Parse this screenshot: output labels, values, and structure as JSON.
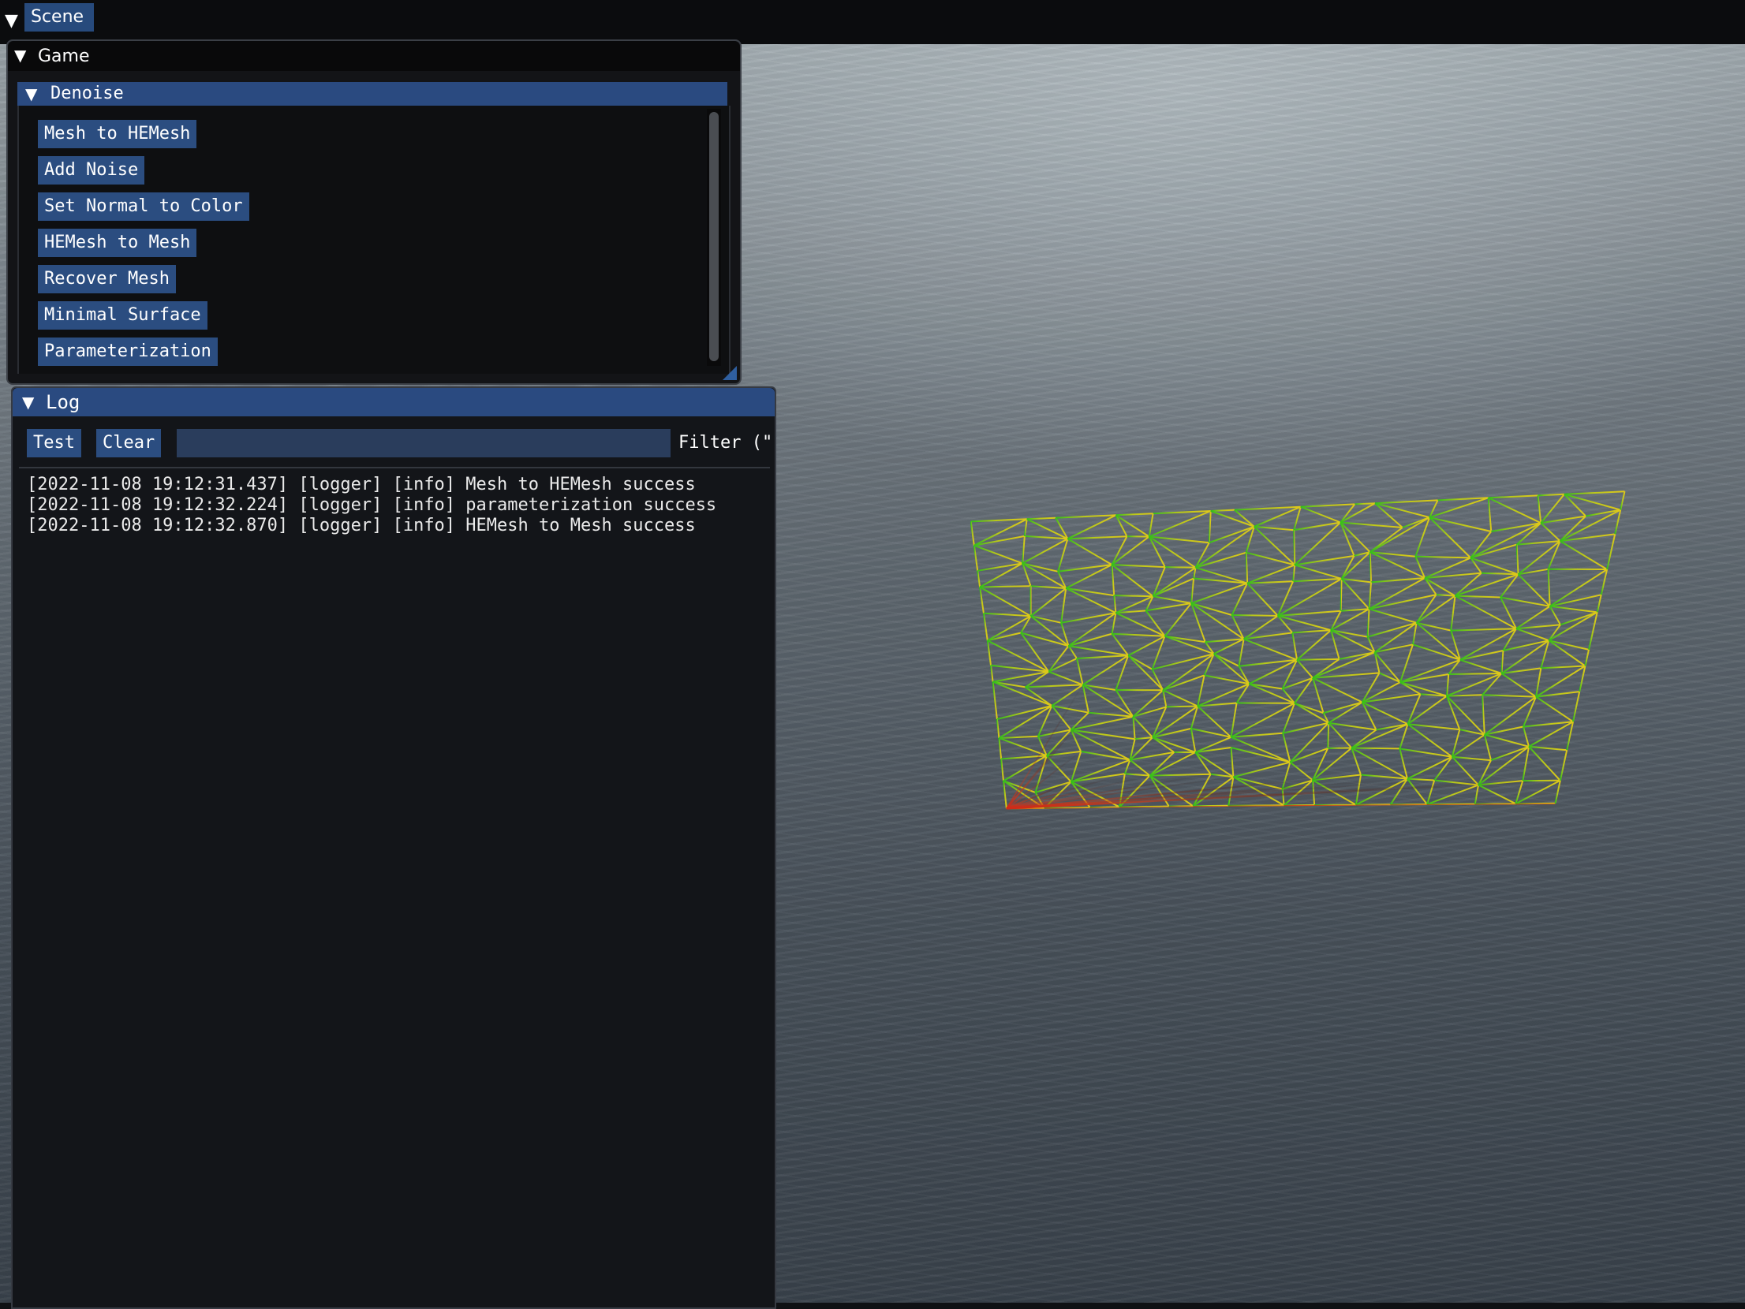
{
  "scene_tab": {
    "label": "Scene"
  },
  "game_window": {
    "title": "Game",
    "section_title": "Denoise",
    "buttons": [
      "Mesh to HEMesh",
      "Add Noise",
      "Set Normal to Color",
      "HEMesh to Mesh",
      "Recover Mesh",
      "Minimal Surface",
      "Parameterization"
    ]
  },
  "log_window": {
    "title": "Log",
    "test_label": "Test",
    "clear_label": "Clear",
    "filter_value": "",
    "filter_label": "Filter (\"",
    "lines": [
      "[2022-11-08 19:12:31.437] [logger] [info] Mesh to HEMesh success",
      "[2022-11-08 19:12:32.224] [logger] [info] parameterization success",
      "[2022-11-08 19:12:32.870] [logger] [info] HEMesh to Mesh success"
    ]
  },
  "colors": {
    "accent": "#2a4a80",
    "button": "#2b4d80",
    "mesh_green": "#2fbf1a",
    "mesh_yellow": "#d8d21a",
    "mesh_red": "#d2301a"
  },
  "icons": {
    "scene_menu": "collapse-triangle-icon",
    "game_collapse": "collapse-triangle-icon",
    "denoise_collapse": "collapse-triangle-icon",
    "log_collapse": "collapse-triangle-icon",
    "resize": "resize-grip-icon"
  }
}
